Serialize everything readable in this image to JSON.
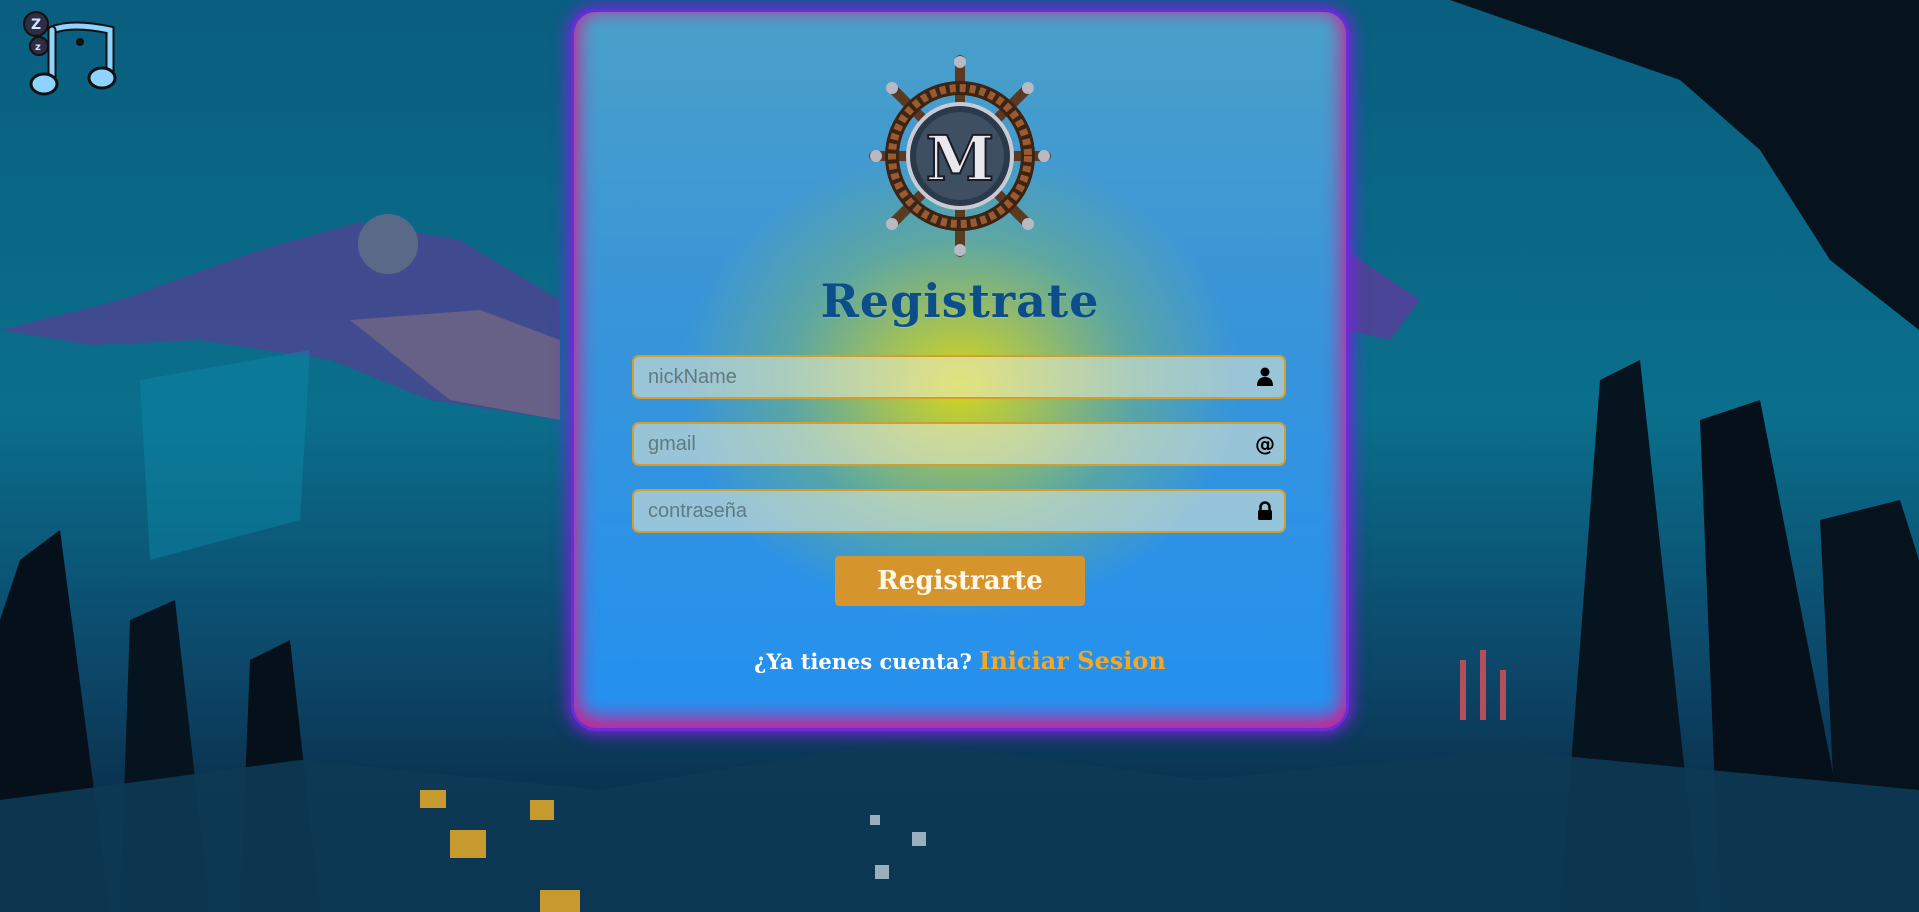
{
  "music_toggle": {
    "icon": "music-sleep-icon",
    "sleep_letters": "Zz"
  },
  "card": {
    "logo": {
      "icon": "ship-wheel-logo",
      "letter": "M"
    },
    "title": "Registrate",
    "fields": {
      "nickname": {
        "placeholder": "nickName",
        "value": "",
        "icon": "user-icon"
      },
      "gmail": {
        "placeholder": "gmail",
        "value": "",
        "icon": "at-icon",
        "glyph": "@"
      },
      "password": {
        "placeholder": "contraseña",
        "value": "",
        "icon": "lock-icon"
      }
    },
    "submit_label": "Registrarte",
    "footer": {
      "prompt": "¿Ya tienes cuenta?",
      "link_label": "Iniciar Sesion"
    }
  },
  "colors": {
    "accent": "#d5952c",
    "title": "#0c4e8a",
    "link": "#f5a623",
    "card_glow": "#7a22e0"
  }
}
